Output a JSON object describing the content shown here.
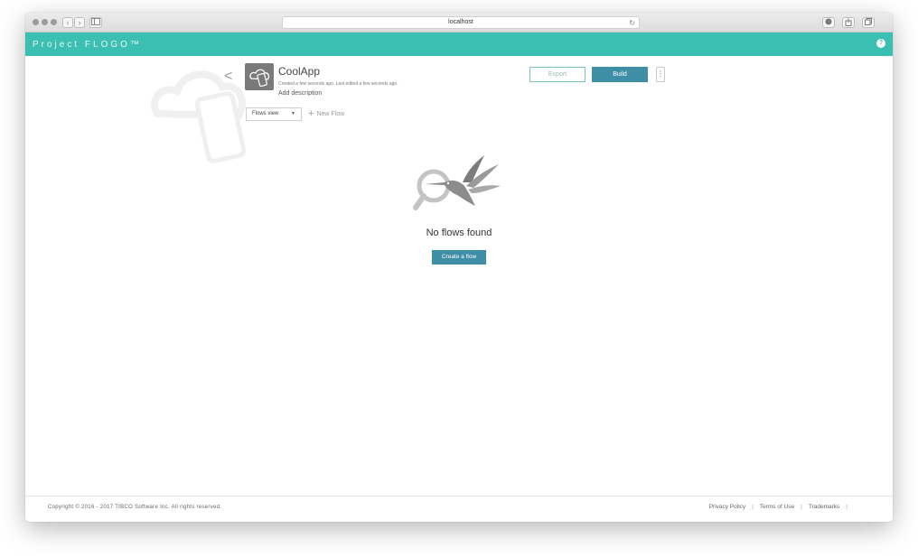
{
  "browser": {
    "url": "localhost",
    "back_glyph": "‹",
    "forward_glyph": "›"
  },
  "header": {
    "brand": "Project FLOGO™",
    "help_glyph": "?"
  },
  "app": {
    "name": "CoolApp",
    "meta": "Created a few seconds ago. Last edited a few seconds ago.",
    "add_description": "Add description"
  },
  "toolbar": {
    "export_label": "Export",
    "build_label": "Build",
    "more_glyph": "⋮",
    "view_label": "Flows view",
    "new_flow_label": "New Flow"
  },
  "empty_state": {
    "message": "No flows found",
    "create_label": "Create a flow"
  },
  "footer": {
    "copyright": "Copyright © 2016 - 2017 TIBCO Software Inc. All rights reserved.",
    "links": [
      "Privacy Policy",
      "Terms of Use",
      "Trademarks"
    ]
  },
  "colors": {
    "brand": "#3bbfb2",
    "primary_button": "#3e8ea6"
  }
}
